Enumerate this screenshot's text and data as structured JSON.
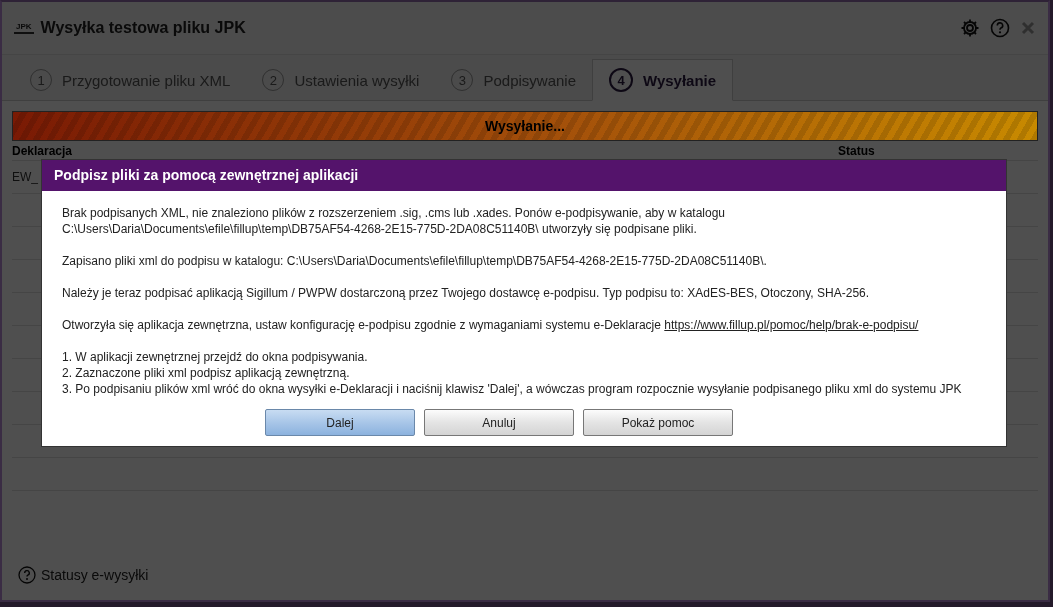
{
  "window": {
    "logo": "JPK",
    "title": "Wysyłka testowa pliku JPK"
  },
  "tabs": [
    {
      "number": "1",
      "label": "Przygotowanie pliku XML",
      "selected": false
    },
    {
      "number": "2",
      "label": "Ustawienia wysyłki",
      "selected": false
    },
    {
      "number": "3",
      "label": "Podpisywanie",
      "selected": false
    },
    {
      "number": "4",
      "label": "Wysyłanie",
      "selected": true
    }
  ],
  "progress": {
    "label": "Wysyłanie...",
    "level": 1
  },
  "table": {
    "columns": [
      "Deklaracja",
      "Status"
    ],
    "rows": [
      [
        "EW_"
      ]
    ]
  },
  "dialog": {
    "title": "Podpisz pliki za pomocą zewnętrznej aplikacji",
    "paragraphs": [
      {
        "lines": [
          "Brak podpisanych XML, nie znaleziono plików z rozszerzeniem .sig, .cms lub .xades. Ponów e-podpisywanie, aby w katalogu C:\\Users\\Daria\\Documents\\efile\\fillup\\temp\\DB75AF54-4268-2E15-775D-2DA08C51140B\\ utworzyły się podpisane pliki."
        ]
      },
      {
        "lines": [
          "Zapisano pliki xml do podpisu w katalogu: C:\\Users\\Daria\\Documents\\efile\\fillup\\temp\\DB75AF54-4268-2E15-775D-2DA08C51140B\\."
        ]
      },
      {
        "lines": [
          "Należy je teraz podpisać aplikacją Sigillum / PWPW dostarczoną przez Twojego dostawcę e-podpisu. Typ podpisu to: XAdES-BES, Otoczony, SHA-256."
        ]
      },
      {
        "lines": [
          "Otworzyła się aplikacja zewnętrzna, ustaw konfigurację e-podpisu zgodnie z wymaganiami systemu e-Deklaracje"
        ],
        "link": "https://www.fillup.pl/pomoc/help/brak-e-podpisu/"
      },
      {
        "lines": [
          "1. W aplikacji zewnętrznej przejdź do okna podpisywania.",
          "2. Zaznaczone pliki xml podpisz aplikacją zewnętrzną.",
          "3. Po podpisaniu plików xml wróć do okna wysyłki e-Deklaracji i naciśnij klawisz 'Dalej', a wówczas program rozpocznie wysyłanie podpisanego pliku xml do systemu JPK"
        ]
      }
    ],
    "buttons": [
      {
        "label": "Dalej",
        "kind": "primary"
      },
      {
        "label": "Anuluj",
        "kind": "default"
      },
      {
        "label": "Pokaż pomoc",
        "kind": "default"
      }
    ]
  },
  "footer": {
    "link": "Statusy e-wysyłki"
  }
}
